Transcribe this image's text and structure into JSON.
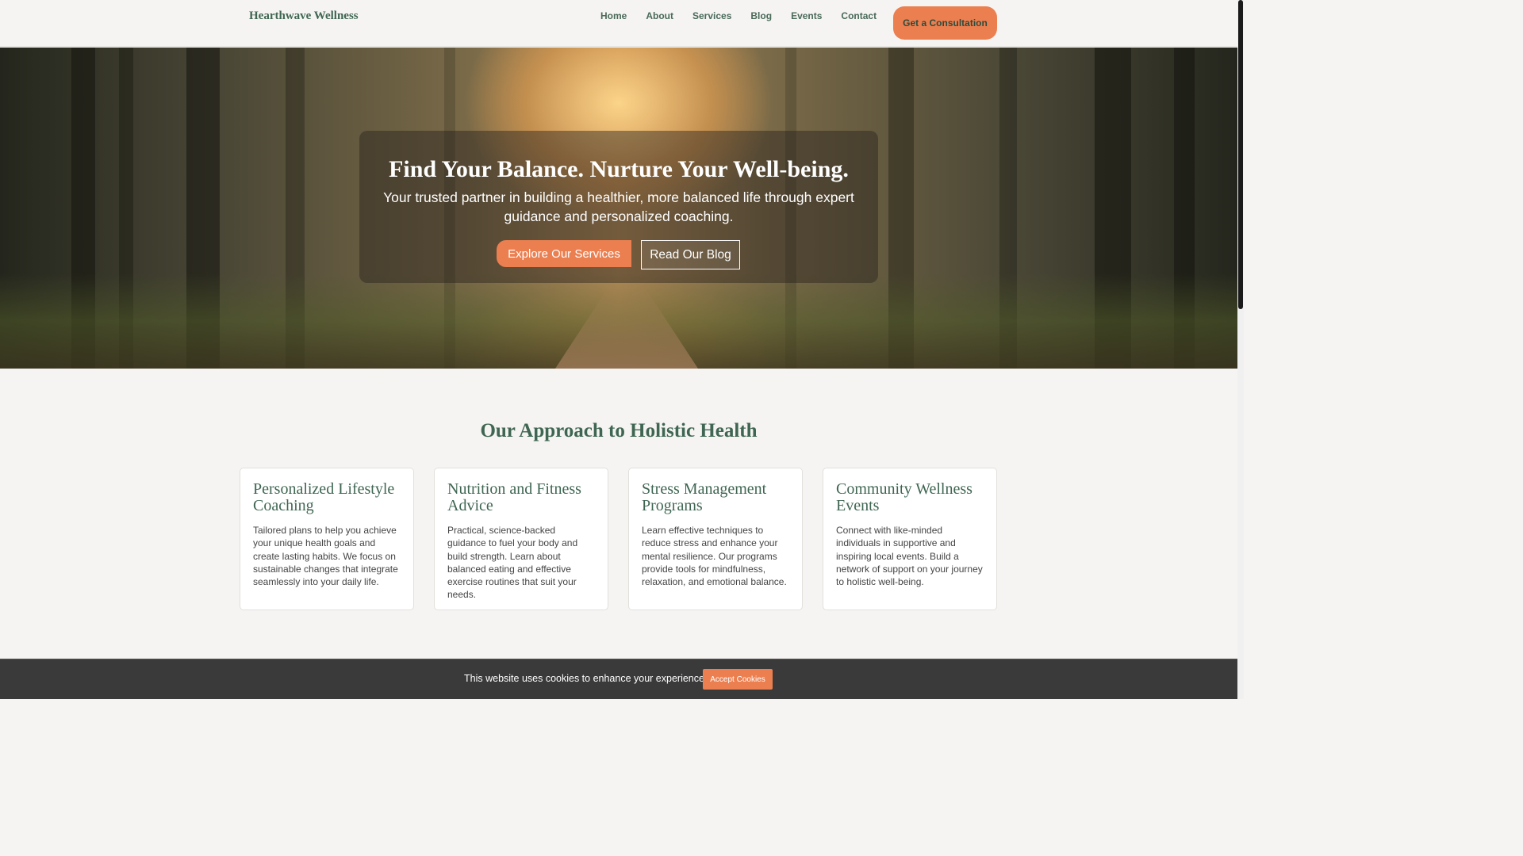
{
  "header": {
    "brand": "Hearthwave Wellness",
    "nav": [
      {
        "label": "Home"
      },
      {
        "label": "About"
      },
      {
        "label": "Services"
      },
      {
        "label": "Blog"
      },
      {
        "label": "Events"
      },
      {
        "label": "Contact"
      }
    ],
    "cta_label": "Get a Consultation"
  },
  "hero": {
    "title": "Find Your Balance. Nurture Your Well-being.",
    "subtitle": "Your trusted partner in building a healthier, more balanced life through expert guidance and personalized coaching.",
    "primary_button": "Explore Our Services",
    "secondary_button": "Read Our Blog"
  },
  "approach": {
    "title": "Our Approach to Holistic Health",
    "cards": [
      {
        "title": "Personalized Lifestyle Coaching",
        "text": "Tailored plans to help you achieve your unique health goals and create lasting habits. We focus on sustainable changes that integrate seamlessly into your daily life."
      },
      {
        "title": "Nutrition and Fitness Advice",
        "text": "Practical, science-backed guidance to fuel your body and build strength. Learn about balanced eating and effective exercise routines that suit your needs."
      },
      {
        "title": "Stress Management Programs",
        "text": "Learn effective techniques to reduce stress and enhance your mental resilience. Our programs provide tools for mindfulness, relaxation, and emotional balance."
      },
      {
        "title": "Community Wellness Events",
        "text": "Connect with like-minded individuals in supportive and inspiring local events. Build a network of support on your journey to holistic well-being."
      }
    ]
  },
  "cookie": {
    "text": "This website uses cookies to enhance your experience.",
    "button": "Accept Cookies"
  },
  "colors": {
    "accent": "#ec7f50",
    "brand_green": "#3f6652",
    "background": "#f5f4f2",
    "cookie_bar": "#3a3a3a"
  }
}
